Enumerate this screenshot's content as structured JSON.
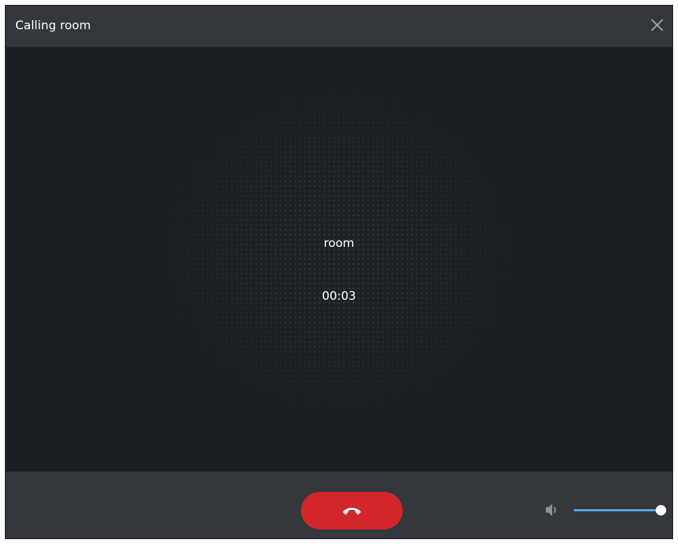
{
  "window": {
    "title": "Calling room",
    "close_icon": "close-icon"
  },
  "call": {
    "callee_name": "room",
    "elapsed": "00:03"
  },
  "controls": {
    "hangup_icon": "phone-hangup-icon",
    "volume_icon": "speaker-icon",
    "volume_level": 1.0,
    "accent_color": "#5aaee8",
    "hangup_color": "#d1262b"
  }
}
